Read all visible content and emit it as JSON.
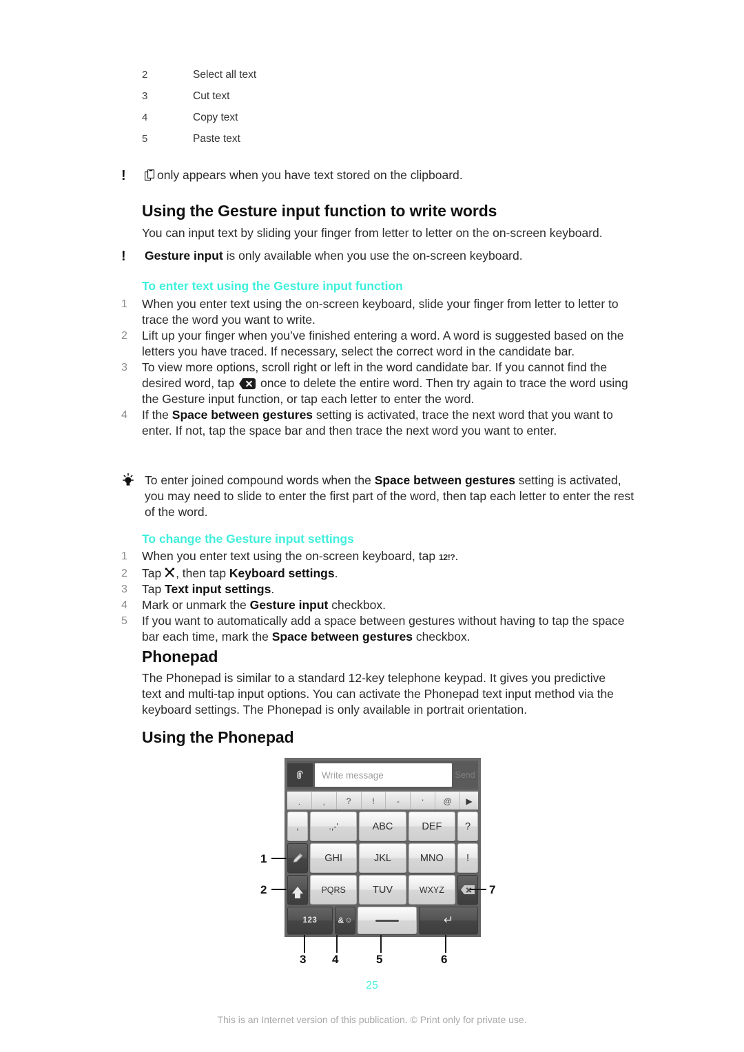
{
  "document": {
    "page_number": "25",
    "footer_text": "This is an Internet version of this publication. © Print only for private use."
  },
  "colors": {
    "heading_accent": "#3FEFDC",
    "body_text": "#2b2b2b",
    "list_number": "#8d8d8d",
    "footer": "#a9a9a9"
  },
  "top_legend": {
    "rows": [
      {
        "num": "2",
        "label": "Select all text"
      },
      {
        "num": "3",
        "label": "Cut text"
      },
      {
        "num": "4",
        "label": "Copy text"
      },
      {
        "num": "5",
        "label": "Paste text"
      }
    ]
  },
  "clipboard_note": {
    "marker": "!",
    "icon": "clipboard-icon",
    "text": "only appears when you have text stored on the clipboard."
  },
  "gesture_section": {
    "heading": "Using the Gesture input function to write words",
    "intro": "You can input text by sliding your finger from letter to letter on the on-screen keyboard.",
    "note": {
      "marker": "!",
      "bold_lead": "Gesture input",
      "rest": " is only available when you use the on-screen keyboard."
    },
    "subheading": "To enter text using the Gesture input function",
    "steps": [
      {
        "num": "1",
        "parts": [
          {
            "t": "When you enter text using the on-screen keyboard, slide your finger from letter to letter to trace the word you want to write."
          }
        ]
      },
      {
        "num": "2",
        "parts": [
          {
            "t": "Lift up your finger when you’ve finished entering a word. A word is suggested based on the letters you have traced. If necessary, select the correct word in the candidate bar."
          }
        ]
      },
      {
        "num": "3",
        "parts": [
          {
            "t": "To view more options, scroll right or left in the word candidate bar. If you cannot find the desired word, tap "
          },
          {
            "icon": "delete-key-icon"
          },
          {
            "t": " once to delete the entire word. Then try again to trace the word using the Gesture input function, or tap each letter to enter the word."
          }
        ]
      },
      {
        "num": "4",
        "parts": [
          {
            "t": "If the "
          },
          {
            "b": "Space between gestures"
          },
          {
            "t": " setting is activated, trace the next word that you want to enter. If not, tap the space bar and then trace the next word you want to enter."
          }
        ]
      }
    ],
    "tip": {
      "icon": "lightbulb-icon",
      "lead": "To enter joined compound words when the ",
      "bold": "Space between gestures",
      "rest": " setting is activated, you may need to slide to enter the first part of the word, then tap each letter to enter the rest of the word."
    },
    "settings_subheading": "To change the Gesture input settings",
    "settings_steps": [
      {
        "num": "1",
        "parts": [
          {
            "t": "When you enter text using the on-screen keyboard, tap "
          },
          {
            "k": "12!?"
          },
          {
            "t": "."
          }
        ]
      },
      {
        "num": "2",
        "parts": [
          {
            "t": "Tap "
          },
          {
            "icon": "tools-icon"
          },
          {
            "t": ", then tap "
          },
          {
            "b": "Keyboard settings"
          },
          {
            "t": "."
          }
        ]
      },
      {
        "num": "3",
        "parts": [
          {
            "t": "Tap "
          },
          {
            "b": "Text input settings"
          },
          {
            "t": "."
          }
        ]
      },
      {
        "num": "4",
        "parts": [
          {
            "t": "Mark or unmark the "
          },
          {
            "b": "Gesture input"
          },
          {
            "t": " checkbox."
          }
        ]
      },
      {
        "num": "5",
        "parts": [
          {
            "t": "If you want to automatically add a space between gestures without having to tap the space bar each time, mark the "
          },
          {
            "b": "Space between gestures"
          },
          {
            "t": " checkbox."
          }
        ]
      }
    ]
  },
  "phonepad_section": {
    "heading": "Phonepad",
    "paragraph": "The Phonepad is similar to a standard 12-key telephone keypad. It gives you predictive text and multi-tap input options. You can activate the Phonepad text input method via the keyboard settings. The Phonepad is only available in portrait orientation.",
    "using_heading": "Using the Phonepad"
  },
  "keyboard_figure": {
    "attach_icon": "attachment-icon",
    "message_placeholder": "Write message",
    "send_label": "Send",
    "candidate_bar": [
      ".",
      ",",
      "?",
      "!",
      "-",
      "'",
      "@"
    ],
    "candidate_arrow_icon": "arrow-right-icon",
    "rows": [
      [
        {
          "label": ",",
          "type": "light",
          "size": "narrow"
        },
        {
          "label": ".,-'",
          "type": "light",
          "size": "wide"
        },
        {
          "label": "ABC",
          "type": "light",
          "size": "wide"
        },
        {
          "label": "DEF",
          "type": "light",
          "size": "wide"
        },
        {
          "label": "?",
          "type": "light",
          "size": "narrow"
        }
      ],
      [
        {
          "label": "",
          "icon": "pen-gesture-icon",
          "type": "dark",
          "size": "narrow"
        },
        {
          "label": "GHI",
          "type": "light",
          "size": "wide"
        },
        {
          "label": "JKL",
          "type": "light",
          "size": "wide"
        },
        {
          "label": "MNO",
          "type": "light",
          "size": "wide"
        },
        {
          "label": "!",
          "type": "light",
          "size": "narrow"
        }
      ],
      [
        {
          "label": "",
          "icon": "shift-icon",
          "type": "dark",
          "size": "narrow"
        },
        {
          "label": "PQRS",
          "type": "light",
          "size": "wide"
        },
        {
          "label": "TUV",
          "type": "light",
          "size": "wide"
        },
        {
          "label": "WXYZ",
          "type": "light",
          "size": "wide"
        },
        {
          "label": "",
          "icon": "backspace-icon",
          "type": "dark",
          "size": "narrow"
        }
      ],
      [
        {
          "label": "123",
          "type": "dark",
          "size": "med"
        },
        {
          "label": "&",
          "icon": "emoji-icon",
          "type": "dark",
          "size": "narrow"
        },
        {
          "label": "",
          "icon": "space-icon",
          "type": "light",
          "size": "wide"
        },
        {
          "label": "",
          "icon": "enter-icon",
          "type": "dark",
          "size": "wide"
        }
      ]
    ],
    "callouts": {
      "left": [
        {
          "num": "1",
          "target": "pen-gesture-key"
        },
        {
          "num": "2",
          "target": "shift-key"
        }
      ],
      "right": [
        {
          "num": "7",
          "target": "backspace-key"
        }
      ],
      "bottom": [
        {
          "num": "3",
          "target": "123-key"
        },
        {
          "num": "4",
          "target": "symbols-emoji-key"
        },
        {
          "num": "5",
          "target": "space-key"
        },
        {
          "num": "6",
          "target": "enter-key"
        }
      ]
    }
  }
}
